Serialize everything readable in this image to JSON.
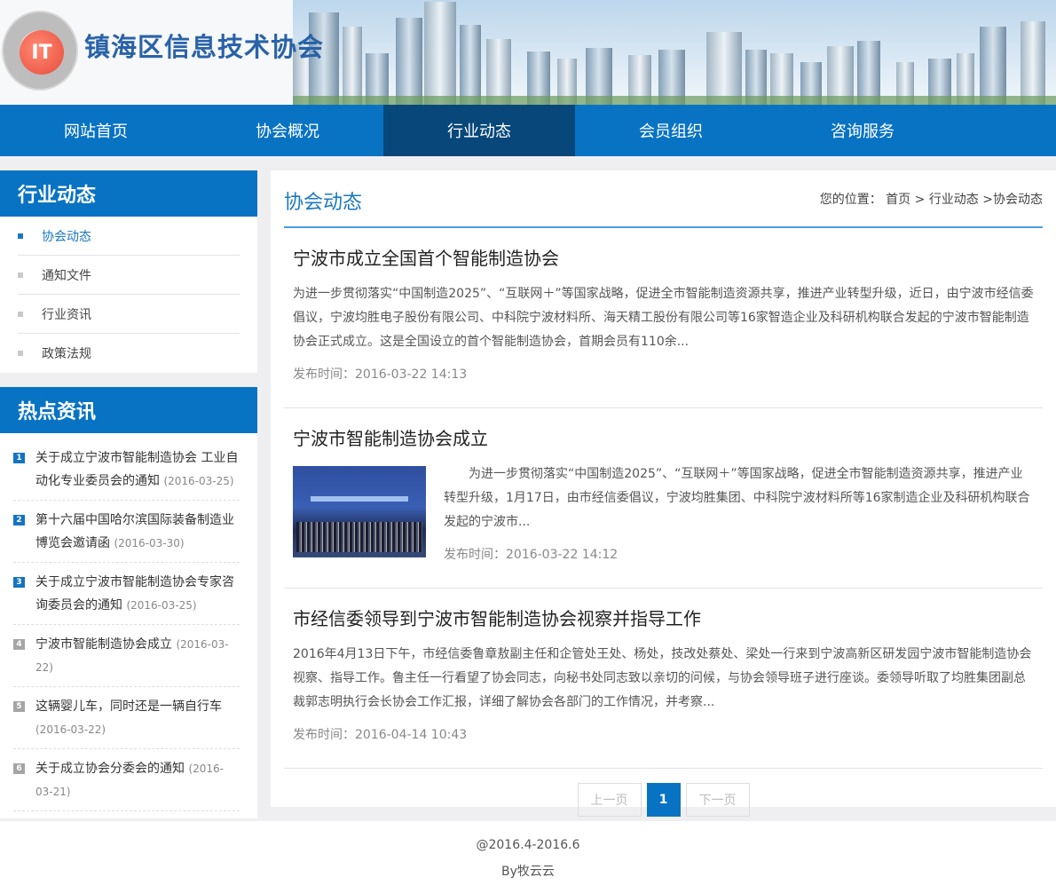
{
  "header": {
    "logo_mark": "IT",
    "site_name": "镇海区信息技术协会"
  },
  "nav": {
    "items": [
      {
        "label": "网站首页"
      },
      {
        "label": "协会概况"
      },
      {
        "label": "行业动态"
      },
      {
        "label": "会员组织"
      },
      {
        "label": "咨询服务"
      }
    ],
    "active_index": 2
  },
  "sidebar": {
    "title": "行业动态",
    "items": [
      {
        "label": "协会动态"
      },
      {
        "label": "通知文件"
      },
      {
        "label": "行业资讯"
      },
      {
        "label": "政策法规"
      }
    ],
    "active_index": 0
  },
  "hot": {
    "title": "热点资讯",
    "items": [
      {
        "num": "1",
        "text": "关于成立宁波市智能制造协会 工业自动化专业委员会的通知",
        "date": "(2016-03-25)"
      },
      {
        "num": "2",
        "text": "第十六届中国哈尔滨国际装备制造业博览会邀请函",
        "date": "(2016-03-30)"
      },
      {
        "num": "3",
        "text": "关于成立宁波市智能制造协会专家咨询委员会的通知",
        "date": "(2016-03-25)"
      },
      {
        "num": "4",
        "text": "宁波市智能制造协会成立",
        "date": "(2016-03-22)"
      },
      {
        "num": "5",
        "text": "这辆婴儿车，同时还是一辆自行车",
        "date": "(2016-03-22)"
      },
      {
        "num": "6",
        "text": "关于成立协会分委会的通知",
        "date": "(2016-03-21)"
      }
    ]
  },
  "main": {
    "title": "协会动态",
    "breadcrumb": {
      "prefix": "您的位置：",
      "home": "首页",
      "sep1": " > ",
      "section": "行业动态",
      "sep2": " >",
      "current": "协会动态"
    },
    "articles": [
      {
        "title": "宁波市成立全国首个智能制造协会",
        "summary": "为进一步贯彻落实“中国制造2025”、“互联网＋”等国家战略，促进全市智能制造资源共享，推进产业转型升级，近日，由宁波市经信委倡议，宁波均胜电子股份有限公司、中科院宁波材料所、海天精工股份有限公司等16家智造企业及科研机构联合发起的宁波市智能制造协会正式成立。这是全国设立的首个智能制造协会，首期会员有110余...",
        "date": "发布时间：2016-03-22 14:13"
      },
      {
        "title": "宁波市智能制造协会成立",
        "summary": "为进一步贯彻落实“中国制造2025”、“互联网＋”等国家战略，促进全市智能制造资源共享，推进产业转型升级，1月17日，由市经信委倡议，宁波均胜集团、中科院宁波材料所等16家制造企业及科研机构联合发起的宁波市...",
        "date": "发布时间：2016-03-22 14:12",
        "thumb_caption": "宁波市智能制造协会成立大会"
      },
      {
        "title": "市经信委领导到宁波市智能制造协会视察并指导工作",
        "summary": "2016年4月13日下午，市经信委鲁章敖副主任和企管处王处、杨处，技改处蔡处、梁处一行来到宁波高新区研发园宁波市智能制造协会视察、指导工作。鲁主任一行看望了协会同志，向秘书处同志致以亲切的问候，与协会领导班子进行座谈。委领导听取了均胜集团副总裁郭志明执行会长协会工作汇报，详细了解协会各部门的工作情况，并考察...",
        "date": "发布时间：2016-04-14 10:43"
      }
    ],
    "pager": {
      "prev": "上一页",
      "current": "1",
      "next": "下一页"
    }
  },
  "footer": {
    "line1": "@2016.4-2016.6",
    "line2": "By牧云云"
  },
  "colors": {
    "primary": "#0873c3",
    "nav_active": "#08477a",
    "accent_text": "#1a78c2"
  }
}
